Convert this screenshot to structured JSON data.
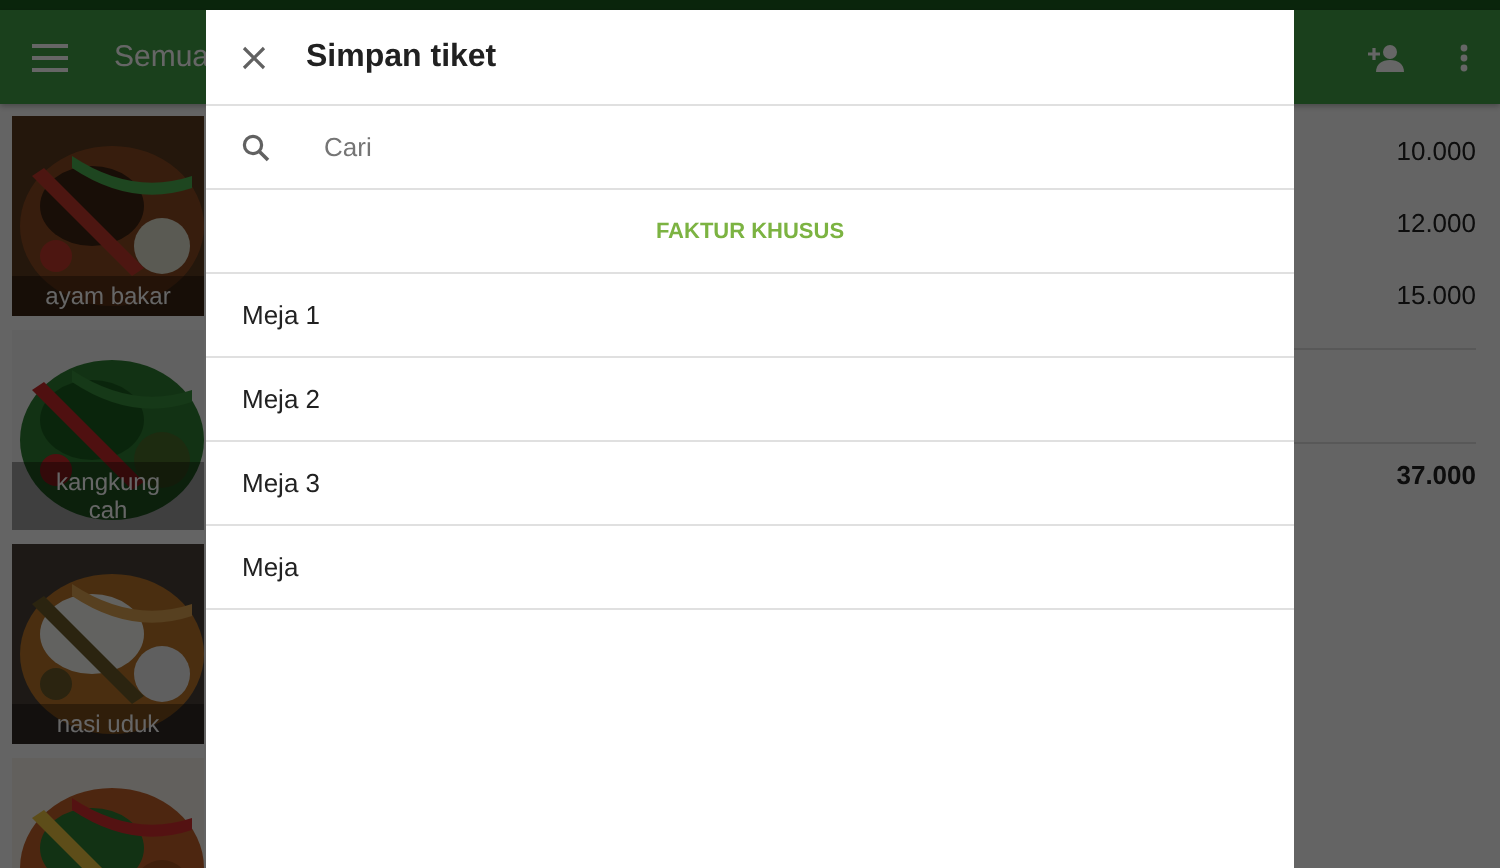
{
  "app_bar": {
    "title": "Semua"
  },
  "tiles": [
    {
      "label": "ayam bakar",
      "kind": "picture"
    },
    {
      "label": "kangkung cah",
      "kind": "picture"
    },
    {
      "label": "nasi uduk",
      "kind": "picture"
    },
    {
      "kind": "picture"
    }
  ],
  "order": {
    "amounts": [
      "10.000",
      "12.000",
      "15.000"
    ],
    "total": "37.000"
  },
  "dialog": {
    "title": "Simpan tiket",
    "search": {
      "placeholder": "Cari"
    },
    "action": "FAKTUR KHUSUS",
    "items": [
      {
        "label": "Meja 1"
      },
      {
        "label": "Meja 2"
      },
      {
        "label": "Meja 3"
      },
      {
        "label": "Meja"
      }
    ]
  }
}
